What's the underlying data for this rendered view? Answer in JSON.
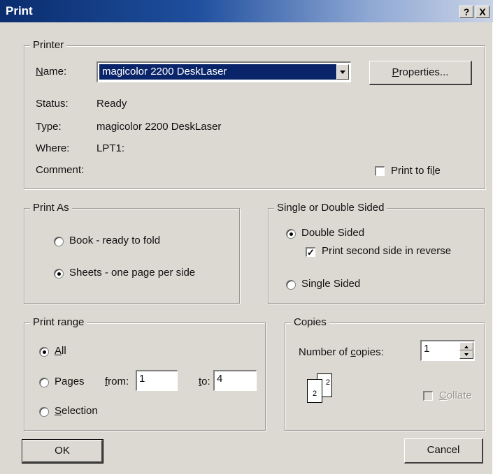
{
  "window": {
    "title": "Print",
    "help_label": "?",
    "close_label": "X"
  },
  "printer": {
    "group_label": "Printer",
    "name_label": "Name:",
    "name_value": "magicolor 2200 DeskLaser",
    "properties_label": "Properties...",
    "status_label": "Status:",
    "status_value": "Ready",
    "type_label": "Type:",
    "type_value": "magicolor 2200 DeskLaser",
    "where_label": "Where:",
    "where_value": "LPT1:",
    "comment_label": "Comment:",
    "print_to_file_label": "Print to file",
    "print_to_file_checked": false
  },
  "print_as": {
    "group_label": "Print As",
    "options": [
      {
        "label": "Book - ready to fold",
        "selected": false
      },
      {
        "label": "Sheets - one page per side",
        "selected": true
      }
    ]
  },
  "sided": {
    "group_label": "Single or Double Sided",
    "double_label": "Double Sided",
    "double_selected": true,
    "reverse_label": "Print second side in reverse",
    "reverse_checked": true,
    "single_label": "Single Sided",
    "single_selected": false
  },
  "print_range": {
    "group_label": "Print range",
    "all_label": "All",
    "pages_label": "Pages",
    "from_label": "from:",
    "from_value": "1",
    "to_label": "to:",
    "to_value": "4",
    "selection_label": "Selection",
    "selected": "All"
  },
  "copies": {
    "group_label": "Copies",
    "number_label": "Number of copies:",
    "number_value": "1",
    "collate_label": "Collate",
    "collate_checked": false,
    "collate_enabled": false,
    "page_icon_labels": [
      "2",
      "2"
    ]
  },
  "buttons": {
    "ok_label": "OK",
    "cancel_label": "Cancel"
  }
}
